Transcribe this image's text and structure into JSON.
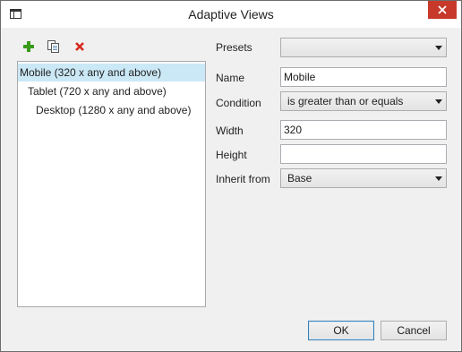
{
  "window": {
    "title": "Adaptive Views"
  },
  "toolbar": {
    "add_icon": "plus-icon",
    "duplicate_icon": "copy-icon",
    "delete_icon": "delete-x-icon"
  },
  "views": [
    {
      "label": "Mobile (320 x any and above)",
      "selected": true
    },
    {
      "label": "Tablet (720 x any and above)",
      "selected": false
    },
    {
      "label": "Desktop (1280 x any and above)",
      "selected": false
    }
  ],
  "form": {
    "presets_label": "Presets",
    "presets_value": "",
    "name_label": "Name",
    "name_value": "Mobile",
    "condition_label": "Condition",
    "condition_value": "is greater than or equals",
    "width_label": "Width",
    "width_value": "320",
    "height_label": "Height",
    "height_value": "",
    "inherit_label": "Inherit from",
    "inherit_value": "Base"
  },
  "buttons": {
    "ok": "OK",
    "cancel": "Cancel"
  },
  "colors": {
    "selection": "#cbe8f6",
    "close": "#c7392b",
    "add": "#3a9a1a",
    "delete": "#d62b1f"
  }
}
